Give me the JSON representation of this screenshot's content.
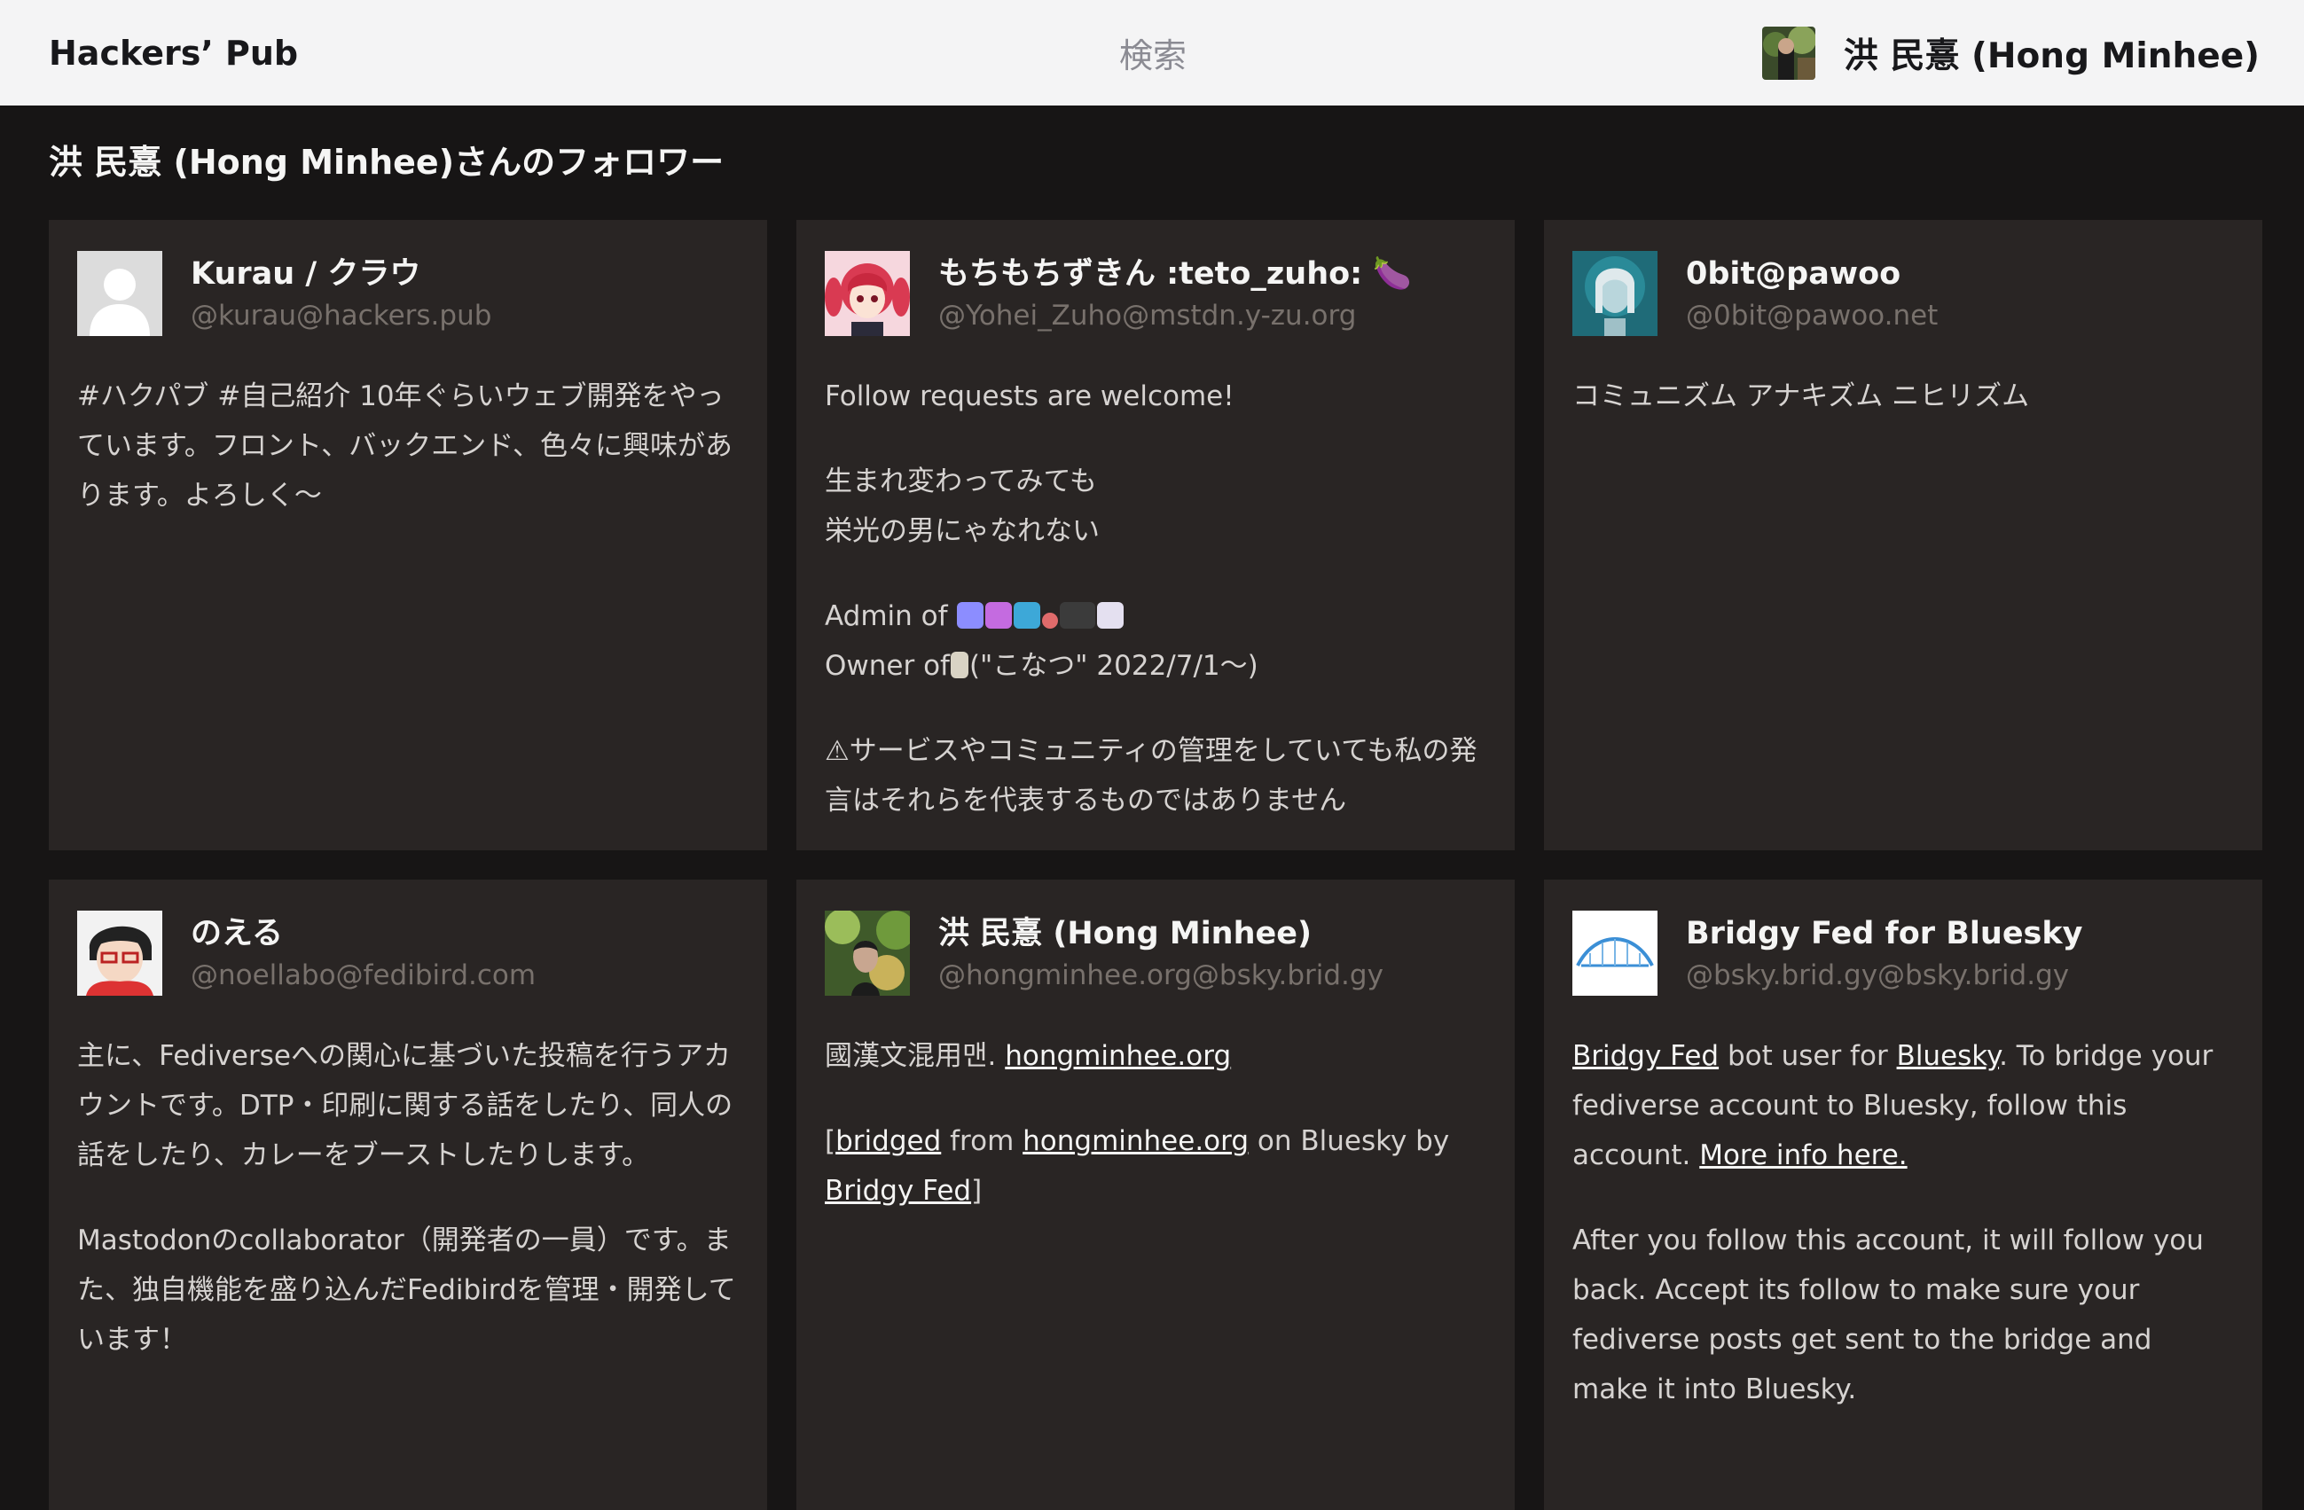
{
  "header": {
    "brand": "Hackers’ Pub",
    "search_label": "検索",
    "user_name": "洪 民憙 (Hong Minhee)"
  },
  "page": {
    "title": "洪 民憙 (Hong Minhee)さんのフォロワー"
  },
  "followers": [
    {
      "name": "Kurau / クラウ",
      "handle": "@kurau@hackers.pub",
      "bio": [
        "#ハクパブ #自己紹介 10年ぐらいウェブ開発をやっています。フロント、バックエンド、色々に興味があります。よろしく〜"
      ]
    },
    {
      "name": "もちもちずきん :teto_zuho: 🍆",
      "handle": "@Yohei_Zuho@mstdn.y-zu.org",
      "bio_p1": "Follow requests are welcome!",
      "bio_p2_line1": "生まれ変わってみても",
      "bio_p2_line2": "栄光の男にゃなれない",
      "admin_label": "Admin of",
      "owner_label": "Owner of",
      "owner_suffix": "(\"こなつ\" 2022/7/1〜)",
      "bio_p4": "⚠サービスやコミュニティの管理をしていても私の発言はそれらを代表するものではありません"
    },
    {
      "name": "0bit@pawoo",
      "handle": "@0bit@pawoo.net",
      "bio": [
        "コミュニズム アナキズム ニヒリズム"
      ]
    },
    {
      "name": "のえる",
      "handle": "@noellabo@fedibird.com",
      "bio": [
        "主に、Fediverseへの関心に基づいた投稿を行うアカウントです。DTP・印刷に関する話をしたり、同人の話をしたり、カレーをブーストしたりします。",
        "Mastodonのcollaborator（開発者の一員）です。また、独自機能を盛り込んだFedibirdを管理・開発しています！"
      ]
    },
    {
      "name": "洪 民憙 (Hong Minhee)",
      "handle": "@hongminhee.org@bsky.brid.gy",
      "bio_p1_text": "國漢文混用맨.",
      "bio_p1_link": "hongminhee.org",
      "bio_p2_open": "[",
      "bio_p2_link1": "bridged",
      "bio_p2_from": "from",
      "bio_p2_link2": "hongminhee.org",
      "bio_p2_mid": "on Bluesky by",
      "bio_p2_link3": "Bridgy Fed",
      "bio_p2_close": "]"
    },
    {
      "name": "Bridgy Fed for Bluesky",
      "handle": "@bsky.brid.gy@bsky.brid.gy",
      "bio_link1": "Bridgy Fed",
      "bio_text1": "bot user for",
      "bio_link2": "Bluesky",
      "bio_text2": ". To bridge your fediverse account to Bluesky, follow this account.",
      "bio_link3": "More info here.",
      "bio_p2": "After you follow this account, it will follow you back. Accept its follow to make sure your fediverse posts get sent to the bridge and make it into Bluesky."
    }
  ],
  "colors": {
    "background": "#171515",
    "card": "#292524",
    "topbar": "#f4f4f5",
    "handle": "#78716c"
  }
}
